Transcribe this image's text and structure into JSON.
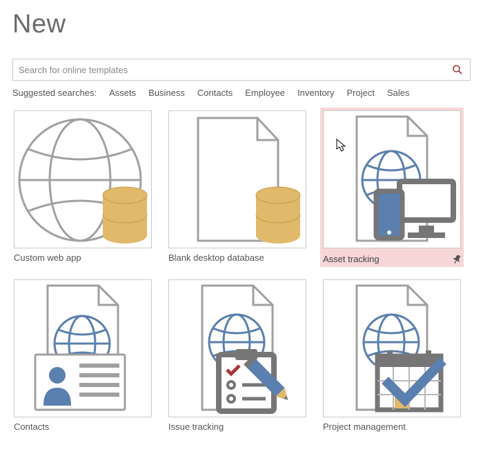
{
  "title": "New",
  "search": {
    "placeholder": "Search for online templates",
    "value": ""
  },
  "suggested": {
    "label": "Suggested searches:",
    "items": [
      "Assets",
      "Business",
      "Contacts",
      "Employee",
      "Inventory",
      "Project",
      "Sales"
    ]
  },
  "templates": {
    "custom_web_app": "Custom web app",
    "blank_db": "Blank desktop database",
    "asset_tracking": "Asset tracking",
    "contacts": "Contacts",
    "issue_tracking": "Issue tracking",
    "project_mgmt": "Project management"
  },
  "colors": {
    "accent": "#a4373a",
    "highlight_bg": "#f6d6d7",
    "border": "#c8c8c8",
    "icon_gray": "#767676",
    "icon_blue": "#5b7fae",
    "icon_gold": "#e0b96a"
  }
}
